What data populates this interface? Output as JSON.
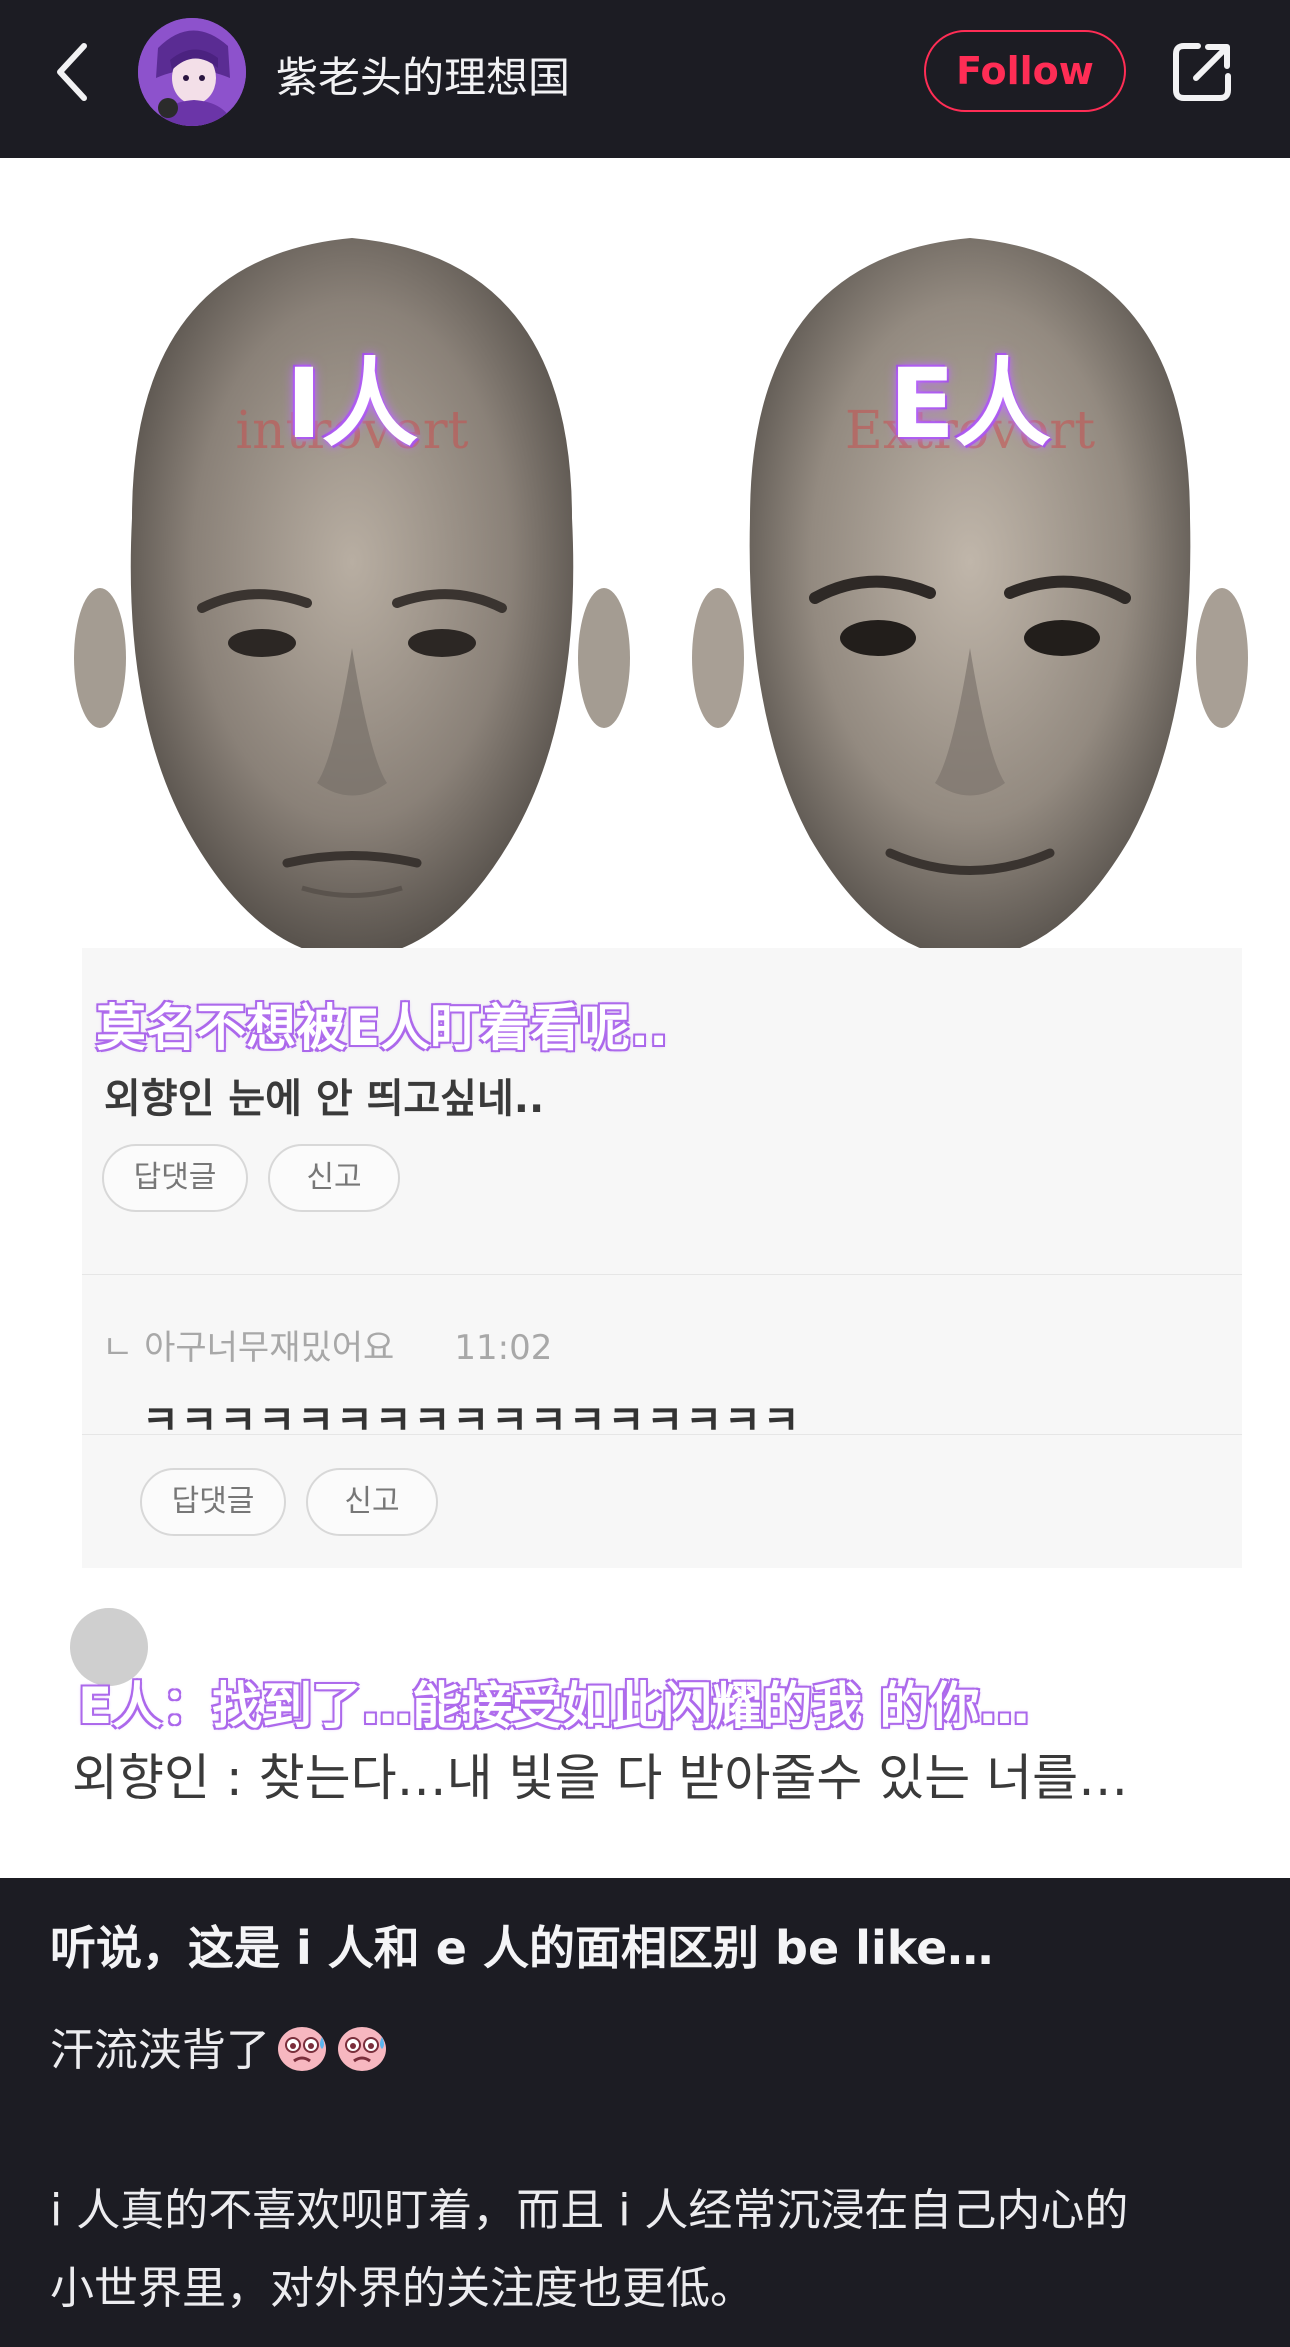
{
  "header": {
    "username": "紫老头的理想国",
    "follow_label": "Follow",
    "back_icon": "chevron-left-icon",
    "share_icon": "share-icon"
  },
  "image": {
    "left_label": "I人",
    "right_label": "E人",
    "caption_1": "莫名不想被E人盯着看呢..",
    "korean_1": "외향인 눈에 안 띄고싶네..",
    "reply_button": "답댓글",
    "report_button": "신고",
    "reply_user": "아구너무재밌어요",
    "reply_time": "11:02",
    "reply_text": "ㅋㅋㅋㅋㅋㅋㅋㅋㅋㅋㅋㅋㅋㅋㅋㅋㅋ",
    "caption_2": "E人：找到了…能接受如此闪耀的我 的你…",
    "korean_2": "외향인 : 찾는다…내 빛을 다 받아줄수 있는 너를…"
  },
  "post": {
    "title": "听说，这是 i 人和 e 人的面相区别 be like…",
    "line1": "汗流浃背了",
    "line2": "i 人真的不喜欢呗盯着，而且 i 人经常沉浸在自己内心的",
    "line3": "小世界里，对外界的关注度也更低。"
  },
  "colors": {
    "background": "#1c1c23",
    "follow_accent": "#ff2d55",
    "caption_purple": "#a864ea"
  }
}
